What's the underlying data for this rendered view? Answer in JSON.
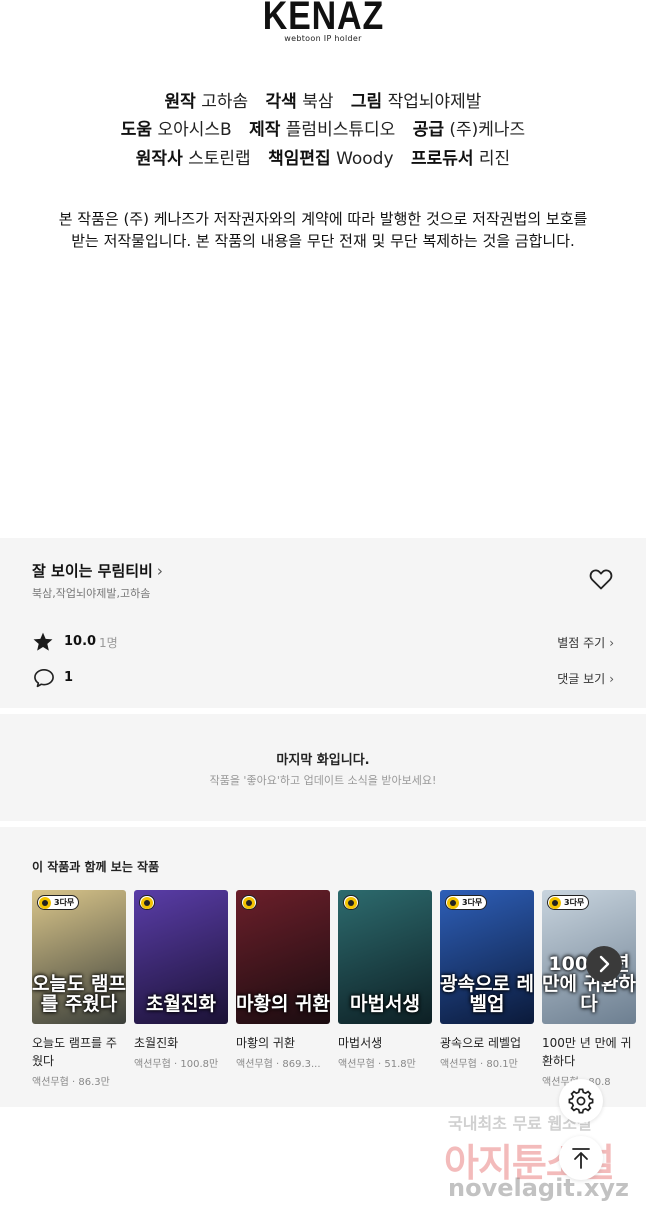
{
  "logo": {
    "name": "KENAZ",
    "tagline": "webtoon IP holder"
  },
  "credits": [
    [
      {
        "role": "원작",
        "name": "고하솜"
      },
      {
        "role": "각색",
        "name": "북삼"
      },
      {
        "role": "그림",
        "name": "작업뇌야제발"
      }
    ],
    [
      {
        "role": "도움",
        "name": "오아시스B"
      },
      {
        "role": "제작",
        "name": "플럼비스튜디오"
      },
      {
        "role": "공급",
        "name": "(주)케나즈"
      }
    ],
    [
      {
        "role": "원작사",
        "name": "스토린랩"
      },
      {
        "role": "책임편집",
        "name": "Woody"
      },
      {
        "role": "프로듀서",
        "name": "리진"
      }
    ]
  ],
  "copyright": {
    "line1": "본 작품은 (주) 케나즈가 저작권자와의 계약에 따라 발행한 것으로 저작권법의 보호를",
    "line2": "받는 저작물입니다. 본 작품의 내용을 무단 전재 및 무단 복제하는 것을 금합니다."
  },
  "work": {
    "title": "잘 보이는 무림티비",
    "title_chevron": "›",
    "authors": "북삼,작업뇌야제발,고하솜",
    "rating": "10.0",
    "rating_count": "1명",
    "rate_action": "별점 주기",
    "comment_count": "1",
    "comment_action": "댓글 보기",
    "chevron": "›"
  },
  "last_episode": {
    "title": "마지막 화입니다.",
    "subtitle": "작품을 '좋아요'하고 업데이트 소식을 받아보세요!"
  },
  "recommendations": {
    "title": "이 작품과 함께 보는 작품",
    "items": [
      {
        "name": "오늘도 램프를 주웠다",
        "genre": "액션무협",
        "views": "86.3만",
        "badge": "3다무",
        "cover_text": "오늘도 램프를 주웠다",
        "colors": [
          "#d9c58a",
          "#3b3f3a"
        ]
      },
      {
        "name": "초월진화",
        "genre": "액션무협",
        "views": "100.8만",
        "badge": "",
        "cover_text": "초월진화",
        "colors": [
          "#5a3da8",
          "#1b1235"
        ]
      },
      {
        "name": "마황의 귀환",
        "genre": "액션무협",
        "views": "869.3...",
        "badge": "",
        "cover_text": "마황의 귀환",
        "colors": [
          "#6b1f2a",
          "#1a0c10"
        ]
      },
      {
        "name": "마법서생",
        "genre": "액션무협",
        "views": "51.8만",
        "badge": "",
        "cover_text": "마법서생",
        "colors": [
          "#2d6b6e",
          "#0d1f24"
        ]
      },
      {
        "name": "광속으로 레벨업",
        "genre": "액션무협",
        "views": "80.1만",
        "badge": "3다무",
        "cover_text": "광속으로 레벨업",
        "colors": [
          "#2e5fb8",
          "#0b1a3a"
        ]
      },
      {
        "name": "100만 년 만에 귀환하다",
        "genre": "액션무협",
        "views": "80.8",
        "badge": "3다무",
        "cover_text": "100만 년 만에 귀환하다",
        "colors": [
          "#c8d4de",
          "#6d7f91"
        ]
      }
    ]
  },
  "watermark": {
    "line1": "국내최초 무료 웹소설",
    "line2": "아지툰소설",
    "line3": "novelagit.xyz"
  },
  "icons": [
    "heart-icon",
    "star-icon",
    "comment-icon",
    "chevron-right-icon",
    "settings-icon",
    "arrow-up-icon",
    "clock-icon"
  ]
}
